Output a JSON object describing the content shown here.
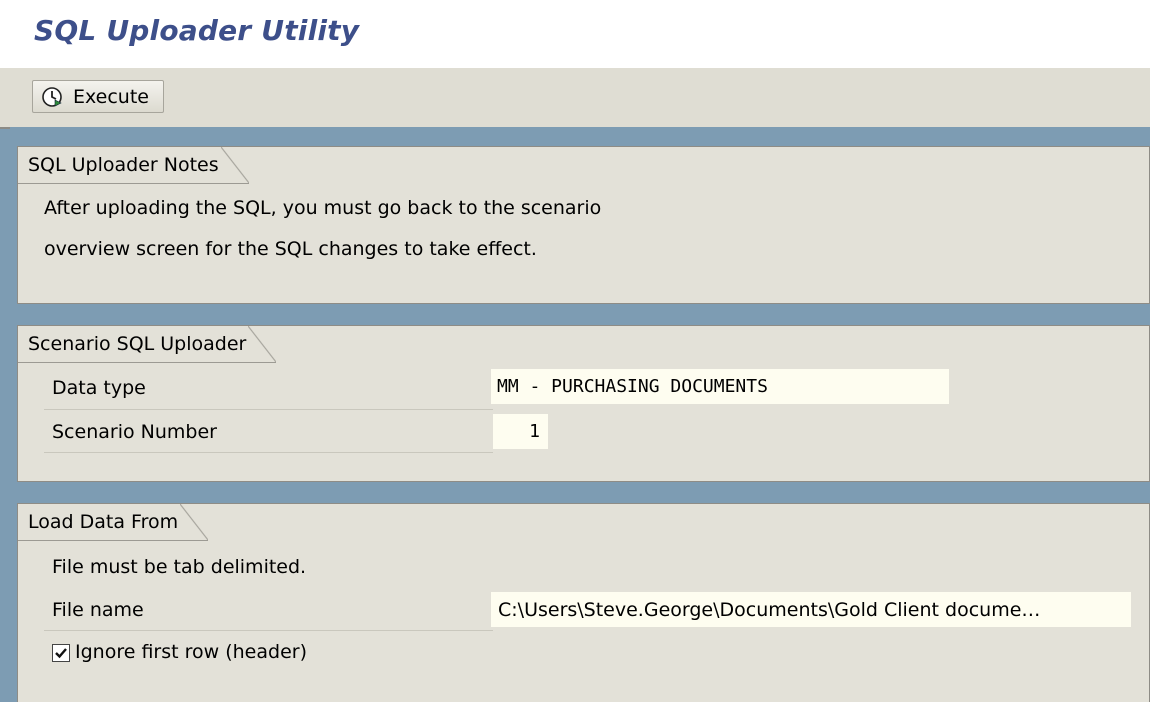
{
  "app": {
    "title": "SQL Uploader Utility"
  },
  "toolbar": {
    "execute_label": "Execute",
    "execute_icon": "clock-execute-icon"
  },
  "notes": {
    "title": "SQL Uploader Notes",
    "line1": "After uploading the SQL, you must go back to the scenario",
    "line2": "overview screen for the SQL changes to take effect."
  },
  "scenario": {
    "title": "Scenario SQL Uploader",
    "data_type_label": "Data type",
    "data_type_value": "MM - PURCHASING DOCUMENTS",
    "scenario_number_label": "Scenario Number",
    "scenario_number_value": "1"
  },
  "load": {
    "title": "Load Data From",
    "hint": "File must be tab delimited.",
    "file_name_label": "File name",
    "file_name_value": "C:\\Users\\Steve.George\\Documents\\Gold Client docume…",
    "ignore_first_row_label": "Ignore first row (header)",
    "ignore_first_row_checked": true
  },
  "colors": {
    "title": "#3d4f8a",
    "background": "#7d9cb3",
    "panel": "#e3e1d8",
    "field": "#fefdf0"
  }
}
